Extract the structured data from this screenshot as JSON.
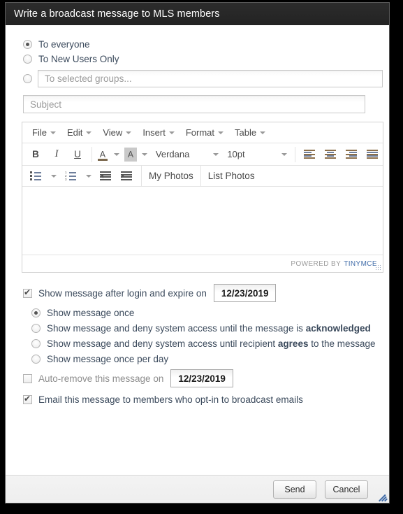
{
  "window": {
    "title": "Write a broadcast message to MLS members"
  },
  "recipients": {
    "options": [
      {
        "label": "To everyone",
        "selected": true
      },
      {
        "label": "To New Users Only",
        "selected": false
      },
      {
        "label": "",
        "selected": false
      }
    ],
    "groups_placeholder": "To selected groups..."
  },
  "subject": {
    "placeholder": "Subject",
    "value": ""
  },
  "editor": {
    "menus": [
      "File",
      "Edit",
      "View",
      "Insert",
      "Format",
      "Table"
    ],
    "format_buttons": {
      "bold": "B",
      "italic": "I",
      "underline": "U",
      "forecolor": "A",
      "backcolor": "A"
    },
    "font_name": "Verdana",
    "font_size": "10pt",
    "photo_buttons": [
      "My Photos",
      "List Photos"
    ],
    "body": "",
    "status_prefix": "POWERED BY",
    "status_brand": "TINYMCE"
  },
  "options": {
    "show_after_login": {
      "label": "Show message after login and expire on",
      "checked": true,
      "date": "12/23/2019"
    },
    "display_modes": [
      {
        "label_pre": "Show message once",
        "label_bold": "",
        "label_post": "",
        "selected": true
      },
      {
        "label_pre": "Show message and deny system access until the message is ",
        "label_bold": "acknowledged",
        "label_post": "",
        "selected": false
      },
      {
        "label_pre": "Show message and deny system access until recipient ",
        "label_bold": "agrees",
        "label_post": " to the message",
        "selected": false
      },
      {
        "label_pre": "Show message once per day",
        "label_bold": "",
        "label_post": "",
        "selected": false
      }
    ],
    "auto_remove": {
      "label": "Auto-remove this message on",
      "checked": false,
      "date": "12/23/2019"
    },
    "email_optin": {
      "label": "Email this message to members who opt-in to broadcast emails",
      "checked": true
    }
  },
  "footer": {
    "send_label": "Send",
    "cancel_label": "Cancel"
  },
  "colors": {
    "titlebar": "#262626",
    "label_text": "#3b4a5c",
    "brand_blue": "#3f6ba8",
    "placeholder": "#9a9a9a"
  }
}
